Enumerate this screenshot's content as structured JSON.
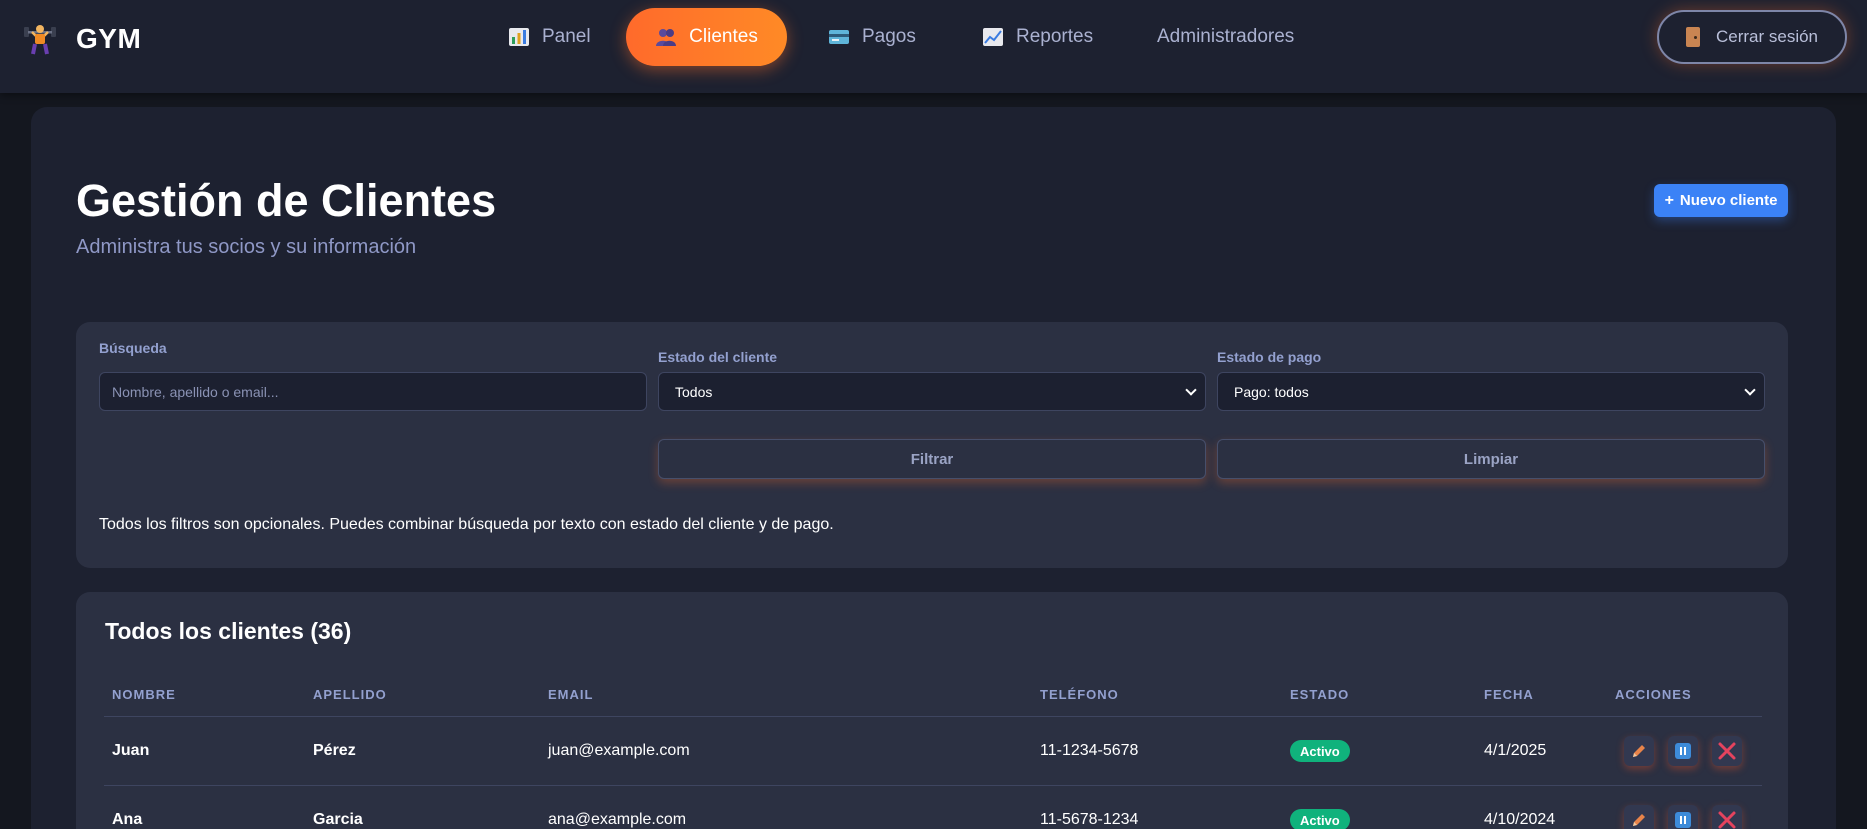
{
  "brand": {
    "name": "GYM",
    "icon": "weightlifter-icon"
  },
  "nav": {
    "items": [
      {
        "label": "Panel",
        "icon": "bar-chart-icon"
      },
      {
        "label": "Clientes",
        "icon": "people-icon",
        "active": true
      },
      {
        "label": "Pagos",
        "icon": "credit-card-icon"
      },
      {
        "label": "Reportes",
        "icon": "trend-chart-icon"
      },
      {
        "label": "Administradores"
      }
    ],
    "logout_label": "Cerrar sesión",
    "logout_icon": "door-icon"
  },
  "header": {
    "title": "Gestión de Clientes",
    "subtitle": "Administra tus socios y su información",
    "new_button": "Nuevo cliente",
    "new_button_icon": "plus-icon"
  },
  "filters": {
    "search_label": "Búsqueda",
    "search_placeholder": "Nombre, apellido o email...",
    "client_status_label": "Estado del cliente",
    "client_status_value": "Todos",
    "payment_status_label": "Estado de pago",
    "payment_status_value": "Pago: todos",
    "filter_button": "Filtrar",
    "clear_button": "Limpiar",
    "hint": "Todos los filtros son opcionales. Puedes combinar búsqueda por texto con estado del cliente y de pago."
  },
  "table": {
    "title": "Todos los clientes (36)",
    "columns": [
      "NOMBRE",
      "APELLIDO",
      "EMAIL",
      "TELÉFONO",
      "ESTADO",
      "FECHA",
      "ACCIONES"
    ],
    "rows": [
      {
        "nombre": "Juan",
        "apellido": "Pérez",
        "email": "juan@example.com",
        "telefono": "11-1234-5678",
        "estado": "Activo",
        "fecha": "4/1/2025"
      },
      {
        "nombre": "Ana",
        "apellido": "Garcia",
        "email": "ana@example.com",
        "telefono": "11-5678-1234",
        "estado": "Activo",
        "fecha": "4/10/2024"
      }
    ],
    "action_icons": [
      "pencil-icon",
      "pause-icon",
      "close-icon"
    ]
  },
  "colors": {
    "accent_orange": "#ff7a2a",
    "primary_blue": "#3b82f6",
    "status_green": "#10b27c",
    "delete_red": "#e5435e"
  }
}
